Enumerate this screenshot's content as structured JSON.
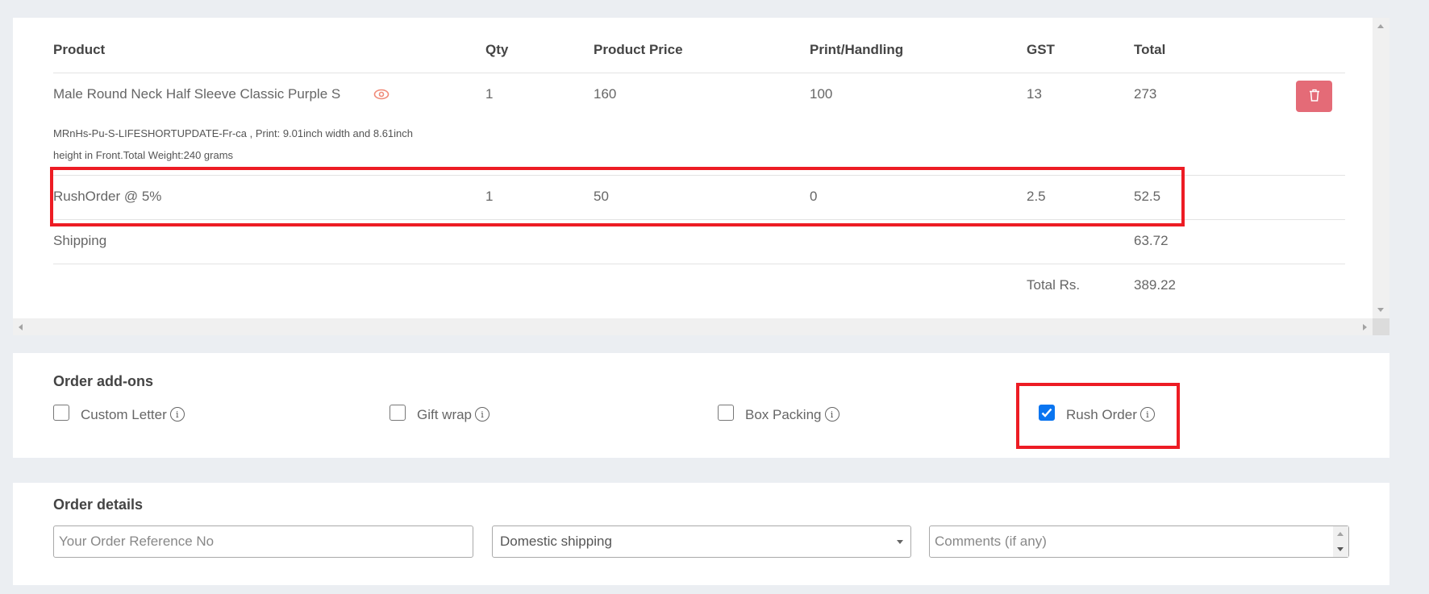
{
  "cart": {
    "columns": [
      "Product",
      "Qty",
      "Product Price",
      "Print/Handling",
      "GST",
      "Total"
    ],
    "product_row": {
      "name": "Male Round Neck Half Sleeve Classic Purple S",
      "qty": "1",
      "price": "160",
      "print_handling": "100",
      "gst": "13",
      "total": "273",
      "description_line1": "MRnHs-Pu-S-LIFESHORTUPDATE-Fr-ca , Print: 9.01inch width and 8.61inch",
      "description_line2": "height in Front.Total Weight:240 grams",
      "view_icon": "eye-icon",
      "delete_icon": "trash-icon"
    },
    "rush_row": {
      "name": "RushOrder @ 5%",
      "qty": "1",
      "price": "50",
      "print_handling": "0",
      "gst": "2.5",
      "total": "52.5"
    },
    "shipping_row": {
      "name": "Shipping",
      "total": "63.72"
    },
    "grand_total": {
      "label": "Total Rs.",
      "value": "389.22"
    }
  },
  "addons": {
    "title": "Order add-ons",
    "items": [
      {
        "label": "Custom Letter",
        "checked": false,
        "icon": "info-icon"
      },
      {
        "label": "Gift wrap",
        "checked": false,
        "icon": "info-icon"
      },
      {
        "label": "Box Packing",
        "checked": false,
        "icon": "info-icon"
      },
      {
        "label": "Rush Order",
        "checked": true,
        "icon": "info-icon"
      }
    ],
    "info_glyph": "i"
  },
  "details": {
    "title": "Order details",
    "reference_placeholder": "Your Order Reference No",
    "reference_value": "",
    "shipping_selected": "Domestic shipping",
    "comments_placeholder": "Comments (if any)",
    "comments_value": ""
  },
  "colors": {
    "highlight": "#ed1c24",
    "delete_button": "#e46b77",
    "checkbox_checked": "#0a75f0",
    "eye_icon": "#f08a78"
  }
}
